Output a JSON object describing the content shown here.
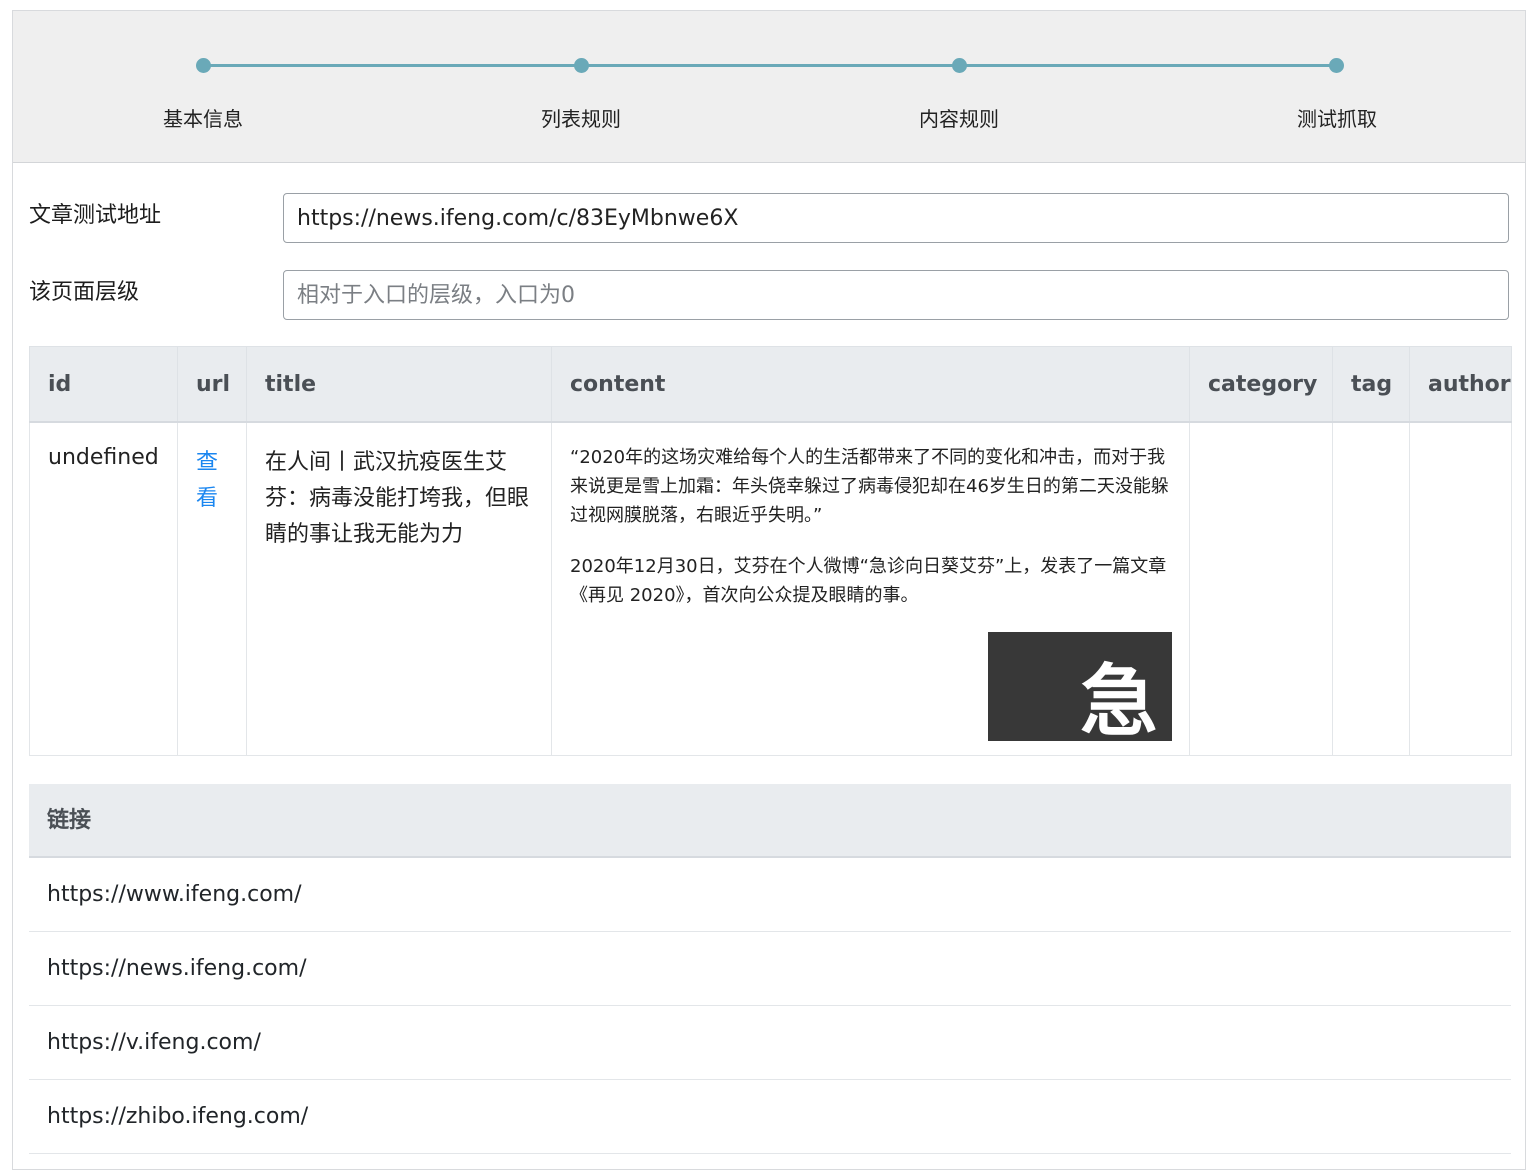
{
  "steps": [
    "基本信息",
    "列表规则",
    "内容规则",
    "测试抓取"
  ],
  "form": {
    "url_label": "文章测试地址",
    "url_value": "https://news.ifeng.com/c/83EyMbnwe6X",
    "level_label": "该页面层级",
    "level_placeholder": "相对于入口的层级，入口为0"
  },
  "table": {
    "columns": [
      "id",
      "url",
      "title",
      "content",
      "category",
      "tag",
      "author"
    ],
    "row": {
      "id": "undefined",
      "url": "查看",
      "title": "在人间丨武汉抗疫医生艾芬：病毒没能打垮我，但眼睛的事让我无能为力",
      "content_p1": "“2020年的这场灾难给每个人的生活都带来了不同的变化和冲击，而对于我来说更是雪上加霜：年头侥幸躲过了病毒侵犯却在46岁生日的第二天没能躲过视网膜脱落，右眼近乎失明。”",
      "content_p2": "2020年12月30日，艾芬在个人微博“急诊向日葵艾芬”上，发表了一篇文章《再见 2020》，首次向公众提及眼睛的事。",
      "content_image_text": "急",
      "category": "",
      "tag": "",
      "author": ""
    }
  },
  "links": {
    "header": "链接",
    "items": [
      "https://www.ifeng.com/",
      "https://news.ifeng.com/",
      "https://v.ifeng.com/",
      "https://zhibo.ifeng.com/"
    ]
  },
  "colors": {
    "step_accent": "#6aa9b8",
    "link": "#1a86f0",
    "header_bg": "#e9ecef"
  }
}
